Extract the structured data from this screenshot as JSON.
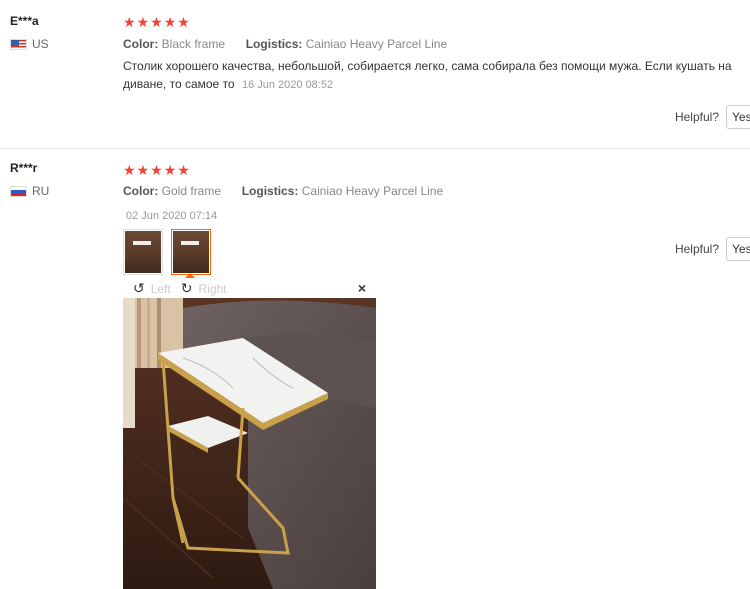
{
  "reviews": [
    {
      "user": "E***a",
      "country": "US",
      "rating": 5,
      "color_label": "Color:",
      "color_value": "Black frame",
      "logistics_label": "Logistics:",
      "logistics_value": "Cainiao Heavy Parcel Line",
      "text": "Столик хорошего качества, небольшой, собирается легко, сама собирала без помощи мужа. Если кушать на диване, то самое то",
      "date": "16 Jun 2020 08:52",
      "helpful_label": "Helpful?",
      "yes_label": "Yes"
    },
    {
      "user": "R***r",
      "country": "RU",
      "rating": 5,
      "color_label": "Color:",
      "color_value": "Gold frame",
      "logistics_label": "Logistics:",
      "logistics_value": "Cainiao Heavy Parcel Line",
      "date": "02 Jun 2020 07:14",
      "helpful_label": "Helpful?",
      "yes_label": "Yes",
      "viewer": {
        "rotate_left_label": "Left",
        "rotate_right_label": "Right",
        "close_glyph": "×"
      }
    }
  ],
  "icons": {
    "star": "★",
    "rotate_left": "↺",
    "rotate_right": "↻"
  },
  "colors": {
    "star": "#f44336",
    "active_thumb_border": "#ff6600"
  }
}
